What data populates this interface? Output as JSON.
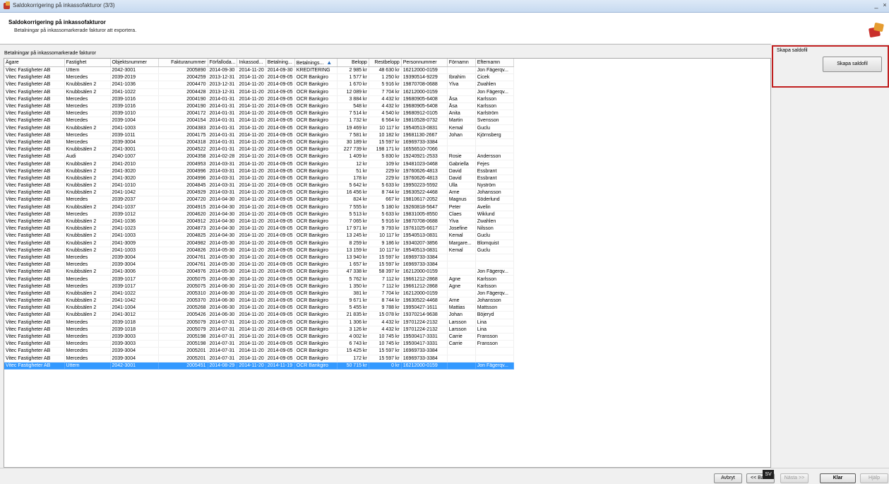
{
  "window": {
    "title": "Saldokorrigering på inkassofakturor (3/3)",
    "minimize": "_",
    "close": "×"
  },
  "header": {
    "title": "Saldokorrigering på inkassofakturor",
    "subtitle": "Betalningar på inkassomarkerade fakturor att exportera."
  },
  "grid": {
    "label": "Betalningar på inkassomarkerade fakturor",
    "columns": [
      "Ägare",
      "Fastighet",
      "Objektsnummer",
      "Fakturanummer",
      "Förfalloda...",
      "Inkassod...",
      "Betalning...",
      "Betalnings...",
      "Belopp",
      "Restbelopp",
      "Personnummer",
      "Förnamn",
      "Efternamn"
    ],
    "sort_icon": "▲",
    "rows": [
      [
        "Vitec Fastigheter AB",
        "Uttern",
        "2042-3001",
        "2005890",
        "2014-09-30",
        "2014-11-20",
        "2014-09-30",
        "KREDITERING",
        "2 985 kr",
        "48 630 kr",
        "16212000-0159",
        "",
        "Jon Fägerqv..."
      ],
      [
        "Vitec Fastigheter AB",
        "Mercedes",
        "2039-2019",
        "2004259",
        "2013-12-31",
        "2014-11-20",
        "2014-09-05",
        "OCR Bankgiro",
        "1 577 kr",
        "1 250 kr",
        "19390514-9229",
        "Ibrahim",
        "Cicek"
      ],
      [
        "Vitec Fastigheter AB",
        "Knubbsälen 2",
        "2041-1036",
        "2004470",
        "2013-12-31",
        "2014-11-20",
        "2014-09-05",
        "OCR Bankgiro",
        "1 670 kr",
        "5 916 kr",
        "19870708-0688",
        "Ylva",
        "Zwahlen"
      ],
      [
        "Vitec Fastigheter AB",
        "Knubbsälen 2",
        "2041-1022",
        "2004428",
        "2013-12-31",
        "2014-11-20",
        "2014-09-05",
        "OCR Bankgiro",
        "12 089 kr",
        "7 704 kr",
        "16212000-0159",
        "",
        "Jon Fägerqv..."
      ],
      [
        "Vitec Fastigheter AB",
        "Mercedes",
        "2039-1016",
        "2004190",
        "2014-01-31",
        "2014-11-20",
        "2014-09-05",
        "OCR Bankgiro",
        "3 884 kr",
        "4 432 kr",
        "19680905-6408",
        "Åsa",
        "Karlsson"
      ],
      [
        "Vitec Fastigheter AB",
        "Mercedes",
        "2039-1016",
        "2004190",
        "2014-01-31",
        "2014-11-20",
        "2014-09-05",
        "OCR Bankgiro",
        "548 kr",
        "4 432 kr",
        "19680905-6408",
        "Åsa",
        "Karlsson"
      ],
      [
        "Vitec Fastigheter AB",
        "Mercedes",
        "2039-1010",
        "2004172",
        "2014-01-31",
        "2014-11-20",
        "2014-09-05",
        "OCR Bankgiro",
        "7 514 kr",
        "4 540 kr",
        "19680912-0105",
        "Anita",
        "Karlström"
      ],
      [
        "Vitec Fastigheter AB",
        "Mercedes",
        "2039-1004",
        "2004154",
        "2014-01-31",
        "2014-11-20",
        "2014-09-05",
        "OCR Bankgiro",
        "1 732 kr",
        "6 564 kr",
        "19810528-0732",
        "Martin",
        "Svensson"
      ],
      [
        "Vitec Fastigheter AB",
        "Knubbsälen 2",
        "2041-1003",
        "2004383",
        "2014-01-31",
        "2014-11-20",
        "2014-09-05",
        "OCR Bankgiro",
        "19 469 kr",
        "10 117 kr",
        "19540513-0831",
        "Kemal",
        "Guclu"
      ],
      [
        "Vitec Fastigheter AB",
        "Mercedes",
        "2039-1011",
        "2004175",
        "2014-01-31",
        "2014-11-20",
        "2014-09-05",
        "OCR Bankgiro",
        "7 581 kr",
        "10 182 kr",
        "19681130-2667",
        "Johan",
        "Kjörnsberg"
      ],
      [
        "Vitec Fastigheter AB",
        "Mercedes",
        "2039-3004",
        "2004318",
        "2014-01-31",
        "2014-11-20",
        "2014-09-05",
        "OCR Bankgiro",
        "30 189 kr",
        "15 597 kr",
        "16969733-3384",
        "",
        ""
      ],
      [
        "Vitec Fastigheter AB",
        "Knubbsälen 2",
        "2041-3001",
        "2004522",
        "2014-01-31",
        "2014-11-20",
        "2014-09-05",
        "OCR Bankgiro",
        "227 739 kr",
        "198 171 kr",
        "16556510-7066",
        "",
        ""
      ],
      [
        "Vitec Fastigheter AB",
        "Audi",
        "2040-1007",
        "2004358",
        "2014-02-28",
        "2014-11-20",
        "2014-09-05",
        "OCR Bankgiro",
        "1 409 kr",
        "5 830 kr",
        "19240921-2533",
        "Rosie",
        "Andersson"
      ],
      [
        "Vitec Fastigheter AB",
        "Knubbsälen 2",
        "2041-2010",
        "2004953",
        "2014-03-31",
        "2014-11-20",
        "2014-09-05",
        "OCR Bankgiro",
        "12 kr",
        "109 kr",
        "19481023-0468",
        "Gabriella",
        "Fejes"
      ],
      [
        "Vitec Fastigheter AB",
        "Knubbsälen 2",
        "2041-3020",
        "2004996",
        "2014-03-31",
        "2014-11-20",
        "2014-09-05",
        "OCR Bankgiro",
        "51 kr",
        "229 kr",
        "19760626-4813",
        "David",
        "Essbrant"
      ],
      [
        "Vitec Fastigheter AB",
        "Knubbsälen 2",
        "2041-3020",
        "2004996",
        "2014-03-31",
        "2014-11-20",
        "2014-09-05",
        "OCR Bankgiro",
        "178 kr",
        "229 kr",
        "19760626-4813",
        "David",
        "Essbrant"
      ],
      [
        "Vitec Fastigheter AB",
        "Knubbsälen 2",
        "2041-1010",
        "2004845",
        "2014-03-31",
        "2014-11-20",
        "2014-09-05",
        "OCR Bankgiro",
        "5 642 kr",
        "5 633 kr",
        "19950223-5592",
        "Ulla",
        "Nyström"
      ],
      [
        "Vitec Fastigheter AB",
        "Knubbsälen 2",
        "2041-1042",
        "2004929",
        "2014-03-31",
        "2014-11-20",
        "2014-09-05",
        "OCR Bankgiro",
        "16 456 kr",
        "8 744 kr",
        "19630522-4468",
        "Arne",
        "Johansson"
      ],
      [
        "Vitec Fastigheter AB",
        "Mercedes",
        "2039-2037",
        "2004720",
        "2014-04-30",
        "2014-11-20",
        "2014-09-05",
        "OCR Bankgiro",
        "824 kr",
        "667 kr",
        "19810617-2052",
        "Magnus",
        "Söderlund"
      ],
      [
        "Vitec Fastigheter AB",
        "Knubbsälen 2",
        "2041-1037",
        "2004915",
        "2014-04-30",
        "2014-11-20",
        "2014-09-05",
        "OCR Bankgiro",
        "7 555 kr",
        "5 180 kr",
        "19260818-5647",
        "Peter",
        "Avelin"
      ],
      [
        "Vitec Fastigheter AB",
        "Mercedes",
        "2039-1012",
        "2004620",
        "2014-04-30",
        "2014-11-20",
        "2014-09-05",
        "OCR Bankgiro",
        "5 513 kr",
        "5 633 kr",
        "19831005-8550",
        "Claes",
        "Wiklund"
      ],
      [
        "Vitec Fastigheter AB",
        "Knubbsälen 2",
        "2041-1036",
        "2004912",
        "2014-04-30",
        "2014-11-20",
        "2014-09-05",
        "OCR Bankgiro",
        "7 065 kr",
        "5 916 kr",
        "19870708-0688",
        "Ylva",
        "Zwahlen"
      ],
      [
        "Vitec Fastigheter AB",
        "Knubbsälen 2",
        "2041-1023",
        "2004873",
        "2014-04-30",
        "2014-11-20",
        "2014-09-05",
        "OCR Bankgiro",
        "17 971 kr",
        "9 793 kr",
        "19761025-6617",
        "Josefine",
        "Nilsson"
      ],
      [
        "Vitec Fastigheter AB",
        "Knubbsälen 2",
        "2041-1003",
        "2004825",
        "2014-04-30",
        "2014-11-20",
        "2014-09-05",
        "OCR Bankgiro",
        "13 245 kr",
        "10 117 kr",
        "19540513-0831",
        "Kemal",
        "Guclu"
      ],
      [
        "Vitec Fastigheter AB",
        "Knubbsälen 2",
        "2041-3009",
        "2004982",
        "2014-05-30",
        "2014-11-20",
        "2014-09-05",
        "OCR Bankgiro",
        "8 259 kr",
        "9 186 kr",
        "19340207-3856",
        "Margare...",
        "Blomquist"
      ],
      [
        "Vitec Fastigheter AB",
        "Knubbsälen 2",
        "2041-1003",
        "2004826",
        "2014-05-30",
        "2014-11-20",
        "2014-09-05",
        "OCR Bankgiro",
        "13 159 kr",
        "10 117 kr",
        "19540513-0831",
        "Kemal",
        "Guclu"
      ],
      [
        "Vitec Fastigheter AB",
        "Mercedes",
        "2039-3004",
        "2004761",
        "2014-05-30",
        "2014-11-20",
        "2014-09-05",
        "OCR Bankgiro",
        "13 940 kr",
        "15 597 kr",
        "16969733-3384",
        "",
        ""
      ],
      [
        "Vitec Fastigheter AB",
        "Mercedes",
        "2039-3004",
        "2004761",
        "2014-05-30",
        "2014-11-20",
        "2014-09-05",
        "OCR Bankgiro",
        "1 657 kr",
        "15 597 kr",
        "16969733-3384",
        "",
        ""
      ],
      [
        "Vitec Fastigheter AB",
        "Knubbsälen 2",
        "2041-3006",
        "2004976",
        "2014-05-30",
        "2014-11-20",
        "2014-09-05",
        "OCR Bankgiro",
        "47 338 kr",
        "58 397 kr",
        "16212000-0159",
        "",
        "Jon Fägerqv..."
      ],
      [
        "Vitec Fastigheter AB",
        "Mercedes",
        "2039-1017",
        "2005075",
        "2014-06-30",
        "2014-11-20",
        "2014-09-05",
        "OCR Bankgiro",
        "5 762 kr",
        "7 112 kr",
        "19661212-2868",
        "Agne",
        "Karlsson"
      ],
      [
        "Vitec Fastigheter AB",
        "Mercedes",
        "2039-1017",
        "2005075",
        "2014-06-30",
        "2014-11-20",
        "2014-09-05",
        "OCR Bankgiro",
        "1 350 kr",
        "7 112 kr",
        "19661212-2868",
        "Agne",
        "Karlsson"
      ],
      [
        "Vitec Fastigheter AB",
        "Knubbsälen 2",
        "2041-1022",
        "2005310",
        "2014-06-30",
        "2014-11-20",
        "2014-09-05",
        "OCR Bankgiro",
        "381 kr",
        "7 704 kr",
        "16212000-0159",
        "",
        "Jon Fägerqv..."
      ],
      [
        "Vitec Fastigheter AB",
        "Knubbsälen 2",
        "2041-1042",
        "2005370",
        "2014-06-30",
        "2014-11-20",
        "2014-09-05",
        "OCR Bankgiro",
        "9 671 kr",
        "8 744 kr",
        "19630522-4468",
        "Arne",
        "Johansson"
      ],
      [
        "Vitec Fastigheter AB",
        "Knubbsälen 2",
        "2041-1004",
        "2005268",
        "2014-06-30",
        "2014-11-20",
        "2014-09-05",
        "OCR Bankgiro",
        "5 455 kr",
        "9 788 kr",
        "19950427-1611",
        "Mattias",
        "Mattsson"
      ],
      [
        "Vitec Fastigheter AB",
        "Knubbsälen 2",
        "2041-3012",
        "2005426",
        "2014-06-30",
        "2014-11-20",
        "2014-09-05",
        "OCR Bankgiro",
        "21 835 kr",
        "15 078 kr",
        "19370214-9638",
        "Johan",
        "Böjeryd"
      ],
      [
        "Vitec Fastigheter AB",
        "Mercedes",
        "2039-1018",
        "2005079",
        "2014-07-31",
        "2014-11-20",
        "2014-09-05",
        "OCR Bankgiro",
        "1 306 kr",
        "4 432 kr",
        "19701224-2132",
        "Larsson",
        "Lina"
      ],
      [
        "Vitec Fastigheter AB",
        "Mercedes",
        "2039-1018",
        "2005079",
        "2014-07-31",
        "2014-11-20",
        "2014-09-05",
        "OCR Bankgiro",
        "3 126 kr",
        "4 432 kr",
        "19701224-2132",
        "Larsson",
        "Lina"
      ],
      [
        "Vitec Fastigheter AB",
        "Mercedes",
        "2039-3003",
        "2005198",
        "2014-07-31",
        "2014-11-20",
        "2014-09-05",
        "OCR Bankgiro",
        "4 002 kr",
        "10 745 kr",
        "19500417-3331",
        "Carrie",
        "Fransson"
      ],
      [
        "Vitec Fastigheter AB",
        "Mercedes",
        "2039-3003",
        "2005198",
        "2014-07-31",
        "2014-11-20",
        "2014-09-05",
        "OCR Bankgiro",
        "6 743 kr",
        "10 745 kr",
        "19500417-3331",
        "Carrie",
        "Fransson"
      ],
      [
        "Vitec Fastigheter AB",
        "Mercedes",
        "2039-3004",
        "2005201",
        "2014-07-31",
        "2014-11-20",
        "2014-09-05",
        "OCR Bankgiro",
        "15 425 kr",
        "15 597 kr",
        "16969733-3384",
        "",
        ""
      ],
      [
        "Vitec Fastigheter AB",
        "Mercedes",
        "2039-3004",
        "2005201",
        "2014-07-31",
        "2014-11-20",
        "2014-09-05",
        "OCR Bankgiro",
        "172 kr",
        "15 597 kr",
        "16969733-3384",
        "",
        ""
      ],
      [
        "Vitec Fastigheter AB",
        "Uttern",
        "2042-3001",
        "2005451",
        "2014-08-29",
        "2014-11-20",
        "2014-11-19",
        "OCR Bankgiro",
        "50 715 kr",
        "0 kr",
        "16212000-0159",
        "",
        "Jon Fägerqv..."
      ]
    ],
    "selected_row": 41
  },
  "side": {
    "group_label": "Skapa saldofil",
    "create_button": "Skapa saldofil"
  },
  "footer": {
    "cancel": "Avbryt",
    "back": "<< Bakåt",
    "next": "Nästa >>",
    "done": "Klar",
    "help": "Hjälp",
    "language": "SV"
  },
  "colors": {
    "selection": "#3399ff",
    "highlight_border": "#c02020"
  }
}
